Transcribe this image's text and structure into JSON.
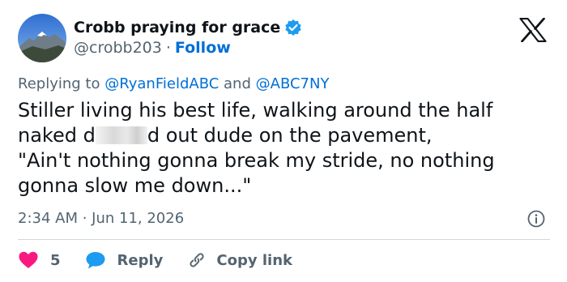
{
  "tweet": {
    "author": {
      "display_name": "Crobb praying for grace",
      "handle": "@crobb203",
      "separator": "·",
      "follow_label": "Follow"
    },
    "reply_context": {
      "prefix": "Replying to",
      "mention_1": "@RyanFieldABC",
      "conjunction": "and",
      "mention_2": "@ABC7NY"
    },
    "text": {
      "line1": "Stiller living his best life, walking around the half",
      "line2_start": "naked d",
      "line2_end": "d out dude on the pavement,",
      "line3": "\"Ain't nothing gonna break my stride, no nothing",
      "line4": "gonna slow me down...\""
    },
    "timestamp": "2:34 AM · Jun 11, 2026",
    "actions": {
      "like_count": "5",
      "reply_label": "Reply",
      "copy_link_label": "Copy link"
    }
  },
  "colors": {
    "link": "#006fd6",
    "secondary_text": "#536471",
    "like": "#f91880",
    "verified": "#1d9bf0"
  },
  "icons": [
    "avatar-image",
    "verified-badge-icon",
    "x-logo-icon",
    "info-icon",
    "heart-icon",
    "reply-bubble-icon",
    "link-icon"
  ]
}
